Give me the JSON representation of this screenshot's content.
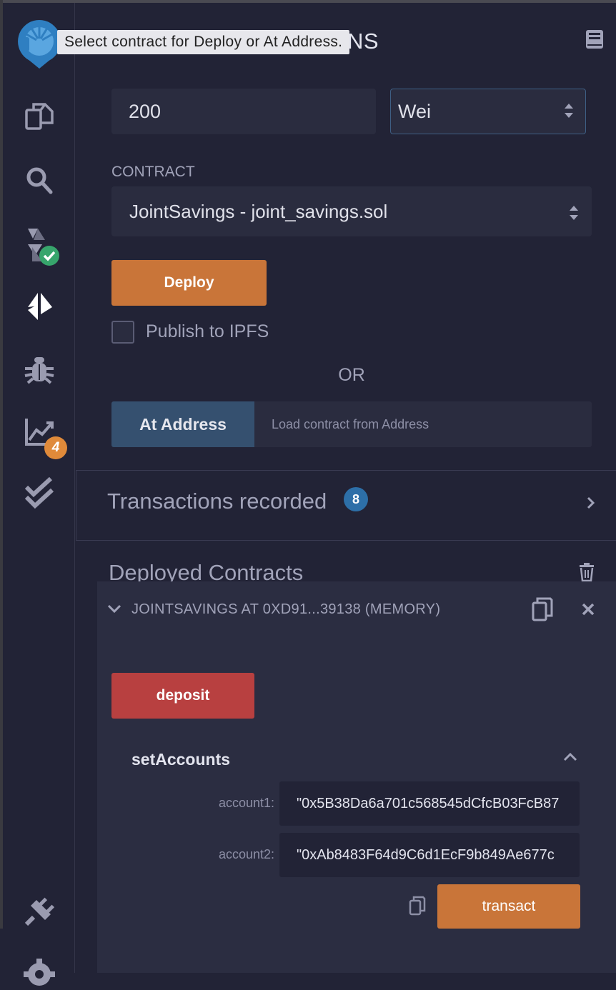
{
  "tooltip": "Select contract for Deploy or At Address.",
  "header": {
    "title": "CTIONS"
  },
  "value": {
    "amount": "200",
    "unit": "Wei"
  },
  "contract": {
    "label": "CONTRACT",
    "selected": "JointSavings - joint_savings.sol"
  },
  "deploy": {
    "label": "Deploy"
  },
  "publish": {
    "label": "Publish to IPFS"
  },
  "or_label": "OR",
  "at_address": {
    "button": "At Address",
    "placeholder": "Load contract from Address"
  },
  "transactions": {
    "label": "Transactions recorded",
    "count": "8"
  },
  "deployed": {
    "label": "Deployed Contracts",
    "instance": "JOINTSAVINGS AT 0XD91...39138 (MEMORY)",
    "deposit": "deposit",
    "function": "setAccounts",
    "params": [
      {
        "name": "account1:",
        "value": "\"0x5B38Da6a701c568545dCfcB03FcB87"
      },
      {
        "name": "account2:",
        "value": "\"0xAb8483F64d9C6d1EcF9b849Ae677c"
      }
    ],
    "transact": "transact"
  },
  "sidebar": {
    "analysis_badge": "4"
  },
  "colors": {
    "accent_orange": "#c97539",
    "danger_red": "#b84040",
    "blue_badge": "#2d6fa8",
    "green_check": "#37a56c"
  }
}
